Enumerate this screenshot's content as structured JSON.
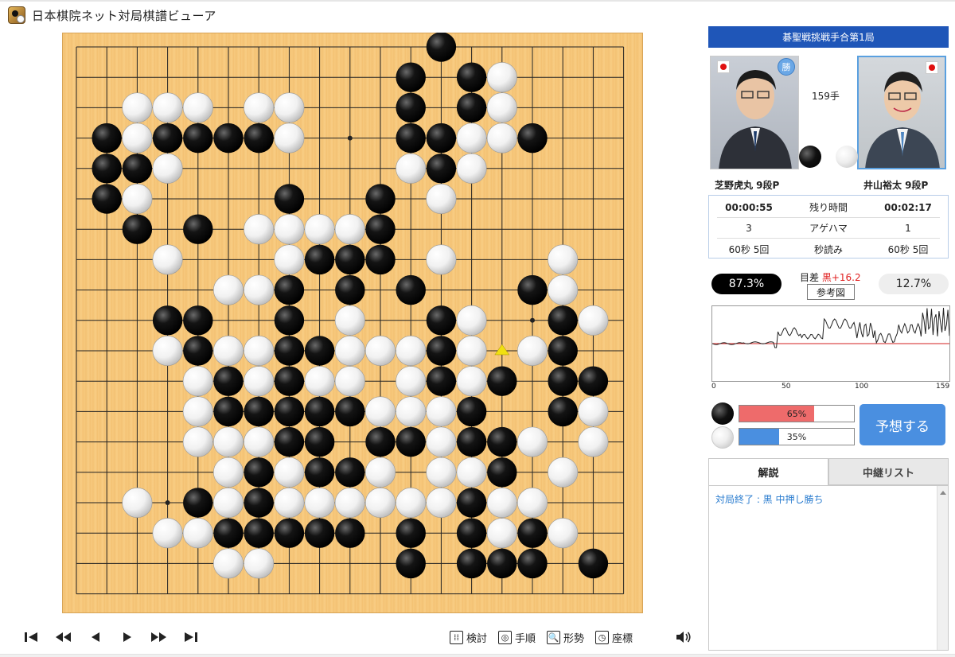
{
  "window": {
    "title": "日本棋院ネット対局棋譜ビューア"
  },
  "tournament": "碁聖戦挑戦手合第1局",
  "black_player": {
    "name": "芝野虎丸 9段P",
    "winner_badge": "勝",
    "time_left": "00:00:55",
    "captures": "3",
    "byoyomi": "60秒 5回",
    "win_rate": "87.3%"
  },
  "white_player": {
    "name": "井山裕太 9段P",
    "time_left": "00:02:17",
    "captures": "1",
    "byoyomi": "60秒 5回",
    "win_rate": "12.7%"
  },
  "move_count": "159手",
  "info_labels": {
    "time": "残り時間",
    "captures": "アゲハマ",
    "byoyomi": "秒読み"
  },
  "score": {
    "label": "目差",
    "value": "黒+16.2",
    "ref_button": "参考図"
  },
  "graph": {
    "axis_labels": [
      "0",
      "50",
      "100",
      "159"
    ],
    "total_moves": 159
  },
  "prediction": {
    "black_pct": 65,
    "black_label": "65%",
    "white_pct": 35,
    "white_label": "35%",
    "button": "予想する"
  },
  "tabs": {
    "commentary": "解説",
    "relay": "中継リスト"
  },
  "commentary_text": "対局終了 : 黒 中押し勝ち",
  "tools": {
    "review": "検討",
    "order": "手順",
    "position": "形勢",
    "coords": "座標"
  },
  "board": {
    "size": 19,
    "black": [
      [
        12,
        0
      ],
      [
        11,
        1
      ],
      [
        13,
        1
      ],
      [
        11,
        2
      ],
      [
        13,
        2
      ],
      [
        1,
        3
      ],
      [
        3,
        3
      ],
      [
        4,
        3
      ],
      [
        5,
        3
      ],
      [
        6,
        3
      ],
      [
        11,
        3
      ],
      [
        12,
        3
      ],
      [
        15,
        3
      ],
      [
        1,
        4
      ],
      [
        2,
        4
      ],
      [
        12,
        4
      ],
      [
        1,
        5
      ],
      [
        7,
        5
      ],
      [
        10,
        5
      ],
      [
        2,
        6
      ],
      [
        4,
        6
      ],
      [
        10,
        6
      ],
      [
        8,
        7
      ],
      [
        9,
        7
      ],
      [
        10,
        7
      ],
      [
        7,
        8
      ],
      [
        9,
        8
      ],
      [
        11,
        8
      ],
      [
        15,
        8
      ],
      [
        3,
        9
      ],
      [
        4,
        9
      ],
      [
        7,
        9
      ],
      [
        12,
        9
      ],
      [
        16,
        9
      ],
      [
        4,
        10
      ],
      [
        7,
        10
      ],
      [
        8,
        10
      ],
      [
        12,
        10
      ],
      [
        16,
        10
      ],
      [
        5,
        11
      ],
      [
        7,
        11
      ],
      [
        12,
        11
      ],
      [
        14,
        11
      ],
      [
        16,
        11
      ],
      [
        17,
        11
      ],
      [
        5,
        12
      ],
      [
        6,
        12
      ],
      [
        7,
        12
      ],
      [
        8,
        12
      ],
      [
        9,
        12
      ],
      [
        13,
        12
      ],
      [
        16,
        12
      ],
      [
        7,
        13
      ],
      [
        8,
        13
      ],
      [
        10,
        13
      ],
      [
        11,
        13
      ],
      [
        13,
        13
      ],
      [
        14,
        13
      ],
      [
        6,
        14
      ],
      [
        8,
        14
      ],
      [
        9,
        14
      ],
      [
        14,
        14
      ],
      [
        4,
        15
      ],
      [
        6,
        15
      ],
      [
        13,
        15
      ],
      [
        5,
        16
      ],
      [
        6,
        16
      ],
      [
        7,
        16
      ],
      [
        8,
        16
      ],
      [
        9,
        16
      ],
      [
        11,
        16
      ],
      [
        13,
        16
      ],
      [
        15,
        16
      ],
      [
        11,
        17
      ],
      [
        13,
        17
      ],
      [
        14,
        17
      ],
      [
        15,
        17
      ],
      [
        17,
        17
      ]
    ],
    "white": [
      [
        14,
        1
      ],
      [
        14,
        2
      ],
      [
        2,
        2
      ],
      [
        3,
        2
      ],
      [
        4,
        2
      ],
      [
        6,
        2
      ],
      [
        7,
        2
      ],
      [
        2,
        3
      ],
      [
        7,
        3
      ],
      [
        13,
        3
      ],
      [
        14,
        3
      ],
      [
        3,
        4
      ],
      [
        11,
        4
      ],
      [
        13,
        4
      ],
      [
        2,
        5
      ],
      [
        12,
        5
      ],
      [
        6,
        6
      ],
      [
        7,
        6
      ],
      [
        8,
        6
      ],
      [
        9,
        6
      ],
      [
        3,
        7
      ],
      [
        7,
        7
      ],
      [
        12,
        7
      ],
      [
        16,
        7
      ],
      [
        5,
        8
      ],
      [
        6,
        8
      ],
      [
        16,
        8
      ],
      [
        9,
        9
      ],
      [
        13,
        9
      ],
      [
        17,
        9
      ],
      [
        3,
        10
      ],
      [
        5,
        10
      ],
      [
        6,
        10
      ],
      [
        9,
        10
      ],
      [
        10,
        10
      ],
      [
        11,
        10
      ],
      [
        13,
        10
      ],
      [
        15,
        10
      ],
      [
        4,
        11
      ],
      [
        6,
        11
      ],
      [
        8,
        11
      ],
      [
        9,
        11
      ],
      [
        11,
        11
      ],
      [
        13,
        11
      ],
      [
        4,
        12
      ],
      [
        10,
        12
      ],
      [
        11,
        12
      ],
      [
        12,
        12
      ],
      [
        17,
        12
      ],
      [
        4,
        13
      ],
      [
        5,
        13
      ],
      [
        6,
        13
      ],
      [
        12,
        13
      ],
      [
        15,
        13
      ],
      [
        17,
        13
      ],
      [
        5,
        14
      ],
      [
        7,
        14
      ],
      [
        10,
        14
      ],
      [
        12,
        14
      ],
      [
        13,
        14
      ],
      [
        16,
        14
      ],
      [
        2,
        15
      ],
      [
        5,
        15
      ],
      [
        7,
        15
      ],
      [
        8,
        15
      ],
      [
        9,
        15
      ],
      [
        10,
        15
      ],
      [
        11,
        15
      ],
      [
        12,
        15
      ],
      [
        14,
        15
      ],
      [
        15,
        15
      ],
      [
        3,
        16
      ],
      [
        4,
        16
      ],
      [
        14,
        16
      ],
      [
        16,
        16
      ],
      [
        5,
        17
      ],
      [
        6,
        17
      ]
    ],
    "last_move": [
      14,
      10
    ]
  },
  "colors": {
    "accent": "#1f56b8",
    "board": "#f5c477",
    "black_bar": "#ee6b6b",
    "white_bar": "#4a8fe0",
    "last_move_marker": "#f0e010"
  }
}
